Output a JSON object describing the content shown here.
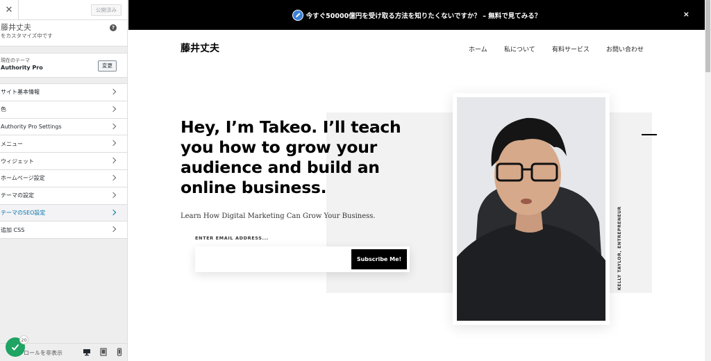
{
  "sidebar": {
    "close_icon": "close-icon",
    "publish_label": "公開済み",
    "site_title": "藤井丈夫",
    "site_subtitle": "をカスタマイズ中です",
    "theme_label": "現在のテーマ",
    "theme_name": "Authority Pro",
    "theme_change_label": "変更",
    "items": [
      {
        "label": "サイト基本情報"
      },
      {
        "label": "色"
      },
      {
        "label": "Authority Pro Settings"
      },
      {
        "label": "メニュー"
      },
      {
        "label": "ウィジェット"
      },
      {
        "label": "ホームページ設定"
      },
      {
        "label": "テーマの設定"
      },
      {
        "label": "テーマのSEO設定"
      },
      {
        "label": "追加 CSS"
      }
    ],
    "footer": {
      "hide_controls_label": "トロールを非表示",
      "badge_count": "20"
    }
  },
  "preview": {
    "banner_text": "今すぐ50000億円を受け取る方法を知りたくないですか？ – 無料で見てみる？",
    "banner_close": "×",
    "site_title": "藤井丈夫",
    "nav": [
      "ホーム",
      "私について",
      "有料サービス",
      "お問い合わせ"
    ],
    "headline": "Hey, I’m Takeo. I’ll teach you how to grow your audience and build an online business.",
    "subline": "Learn How Digital Marketing Can Grow Your Business.",
    "email_label": "ENTER EMAIL ADDRESS...",
    "email_value": "",
    "subscribe_label": "Subscribe Me!",
    "photo_caption": "KELLY TAYLOR, ENTREPRENEUR"
  },
  "colors": {
    "banner_bg": "#000000",
    "sidebar_bg": "#eeeeee",
    "active_item": "#0073aa",
    "badge": "#1fa463"
  }
}
